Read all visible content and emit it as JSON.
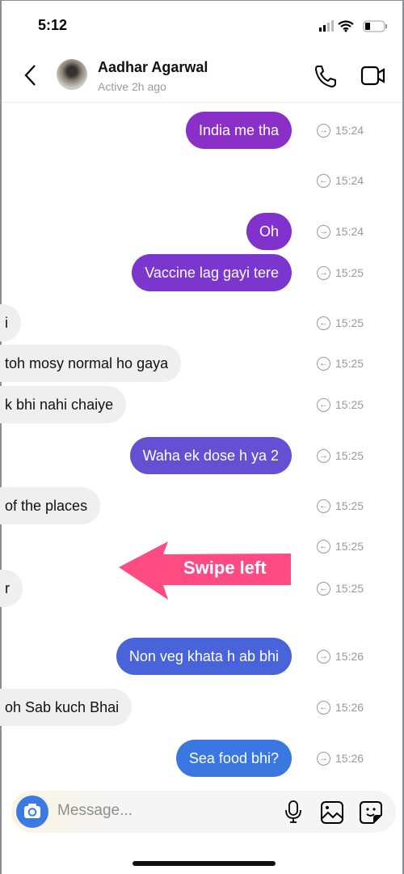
{
  "status_bar": {
    "time": "5:12"
  },
  "header": {
    "name": "Aadhar Agarwal",
    "status": "Active 2h ago"
  },
  "messages": [
    {
      "dir": "sent",
      "text": "India me tha",
      "time": "15:24",
      "color": "#8b2fc9"
    },
    {
      "dir": "recv",
      "text": "",
      "time": "15:24"
    },
    {
      "dir": "sent",
      "text": "Oh",
      "time": "15:24",
      "color": "#8232cc"
    },
    {
      "dir": "sent",
      "text": "Vaccine lag gayi tere",
      "time": "15:25",
      "color": "#7a36ce"
    },
    {
      "dir": "recv",
      "text": "i",
      "time": "15:25"
    },
    {
      "dir": "recv",
      "text": "toh mosy normal ho gaya",
      "time": "15:25"
    },
    {
      "dir": "recv",
      "text": "k bhi nahi chaiye",
      "time": "15:25"
    },
    {
      "dir": "sent",
      "text": "Waha ek dose h ya 2",
      "time": "15:25",
      "color": "#654fd3"
    },
    {
      "dir": "recv",
      "text": "of the places",
      "time": "15:25"
    },
    {
      "dir": "recv",
      "text": "",
      "time": "15:25"
    },
    {
      "dir": "recv",
      "text": "r",
      "time": "15:25"
    },
    {
      "dir": "sent",
      "text": "Non veg khata h ab bhi",
      "time": "15:26",
      "color": "#4963da"
    },
    {
      "dir": "recv",
      "text": "oh Sab kuch Bhai",
      "time": "15:26"
    },
    {
      "dir": "sent",
      "text": "Sea food bhi?",
      "time": "15:26",
      "color": "#3a77e0"
    }
  ],
  "annotation": {
    "text": "Swipe left",
    "color": "#ff4b82"
  },
  "composer": {
    "placeholder": "Message..."
  }
}
